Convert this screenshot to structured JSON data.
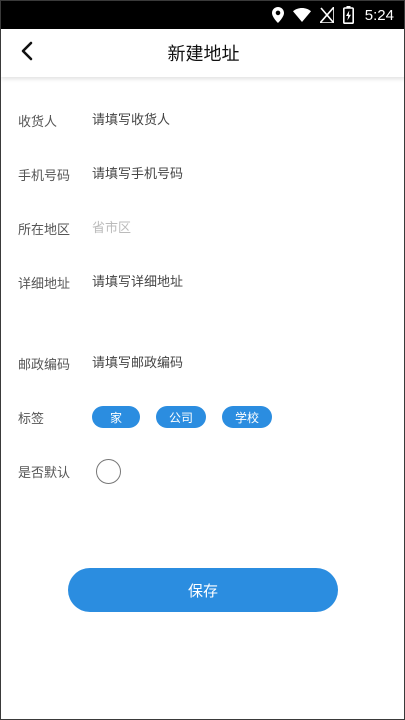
{
  "status_bar": {
    "time": "5:24",
    "icons": [
      "location-icon",
      "wifi-icon",
      "no-signal-icon",
      "battery-charging-icon"
    ]
  },
  "header": {
    "back_icon": "chevron-left-icon",
    "title": "新建地址"
  },
  "form": {
    "recipient": {
      "label": "收货人",
      "placeholder": "请填写收货人",
      "value": ""
    },
    "phone": {
      "label": "手机号码",
      "placeholder": "请填写手机号码",
      "value": ""
    },
    "region": {
      "label": "所在地区",
      "placeholder": "省市区",
      "value": ""
    },
    "detail": {
      "label": "详细地址",
      "placeholder": "请填写详细地址",
      "value": ""
    },
    "postcode": {
      "label": "邮政编码",
      "placeholder": "请填写邮政编码",
      "value": ""
    },
    "tags": {
      "label": "标签",
      "items": [
        "家",
        "公司",
        "学校"
      ]
    },
    "default": {
      "label": "是否默认",
      "checked": false
    }
  },
  "save_label": "保存",
  "colors": {
    "accent": "#2b8de0",
    "placeholder_muted": "#bbbbbb"
  }
}
